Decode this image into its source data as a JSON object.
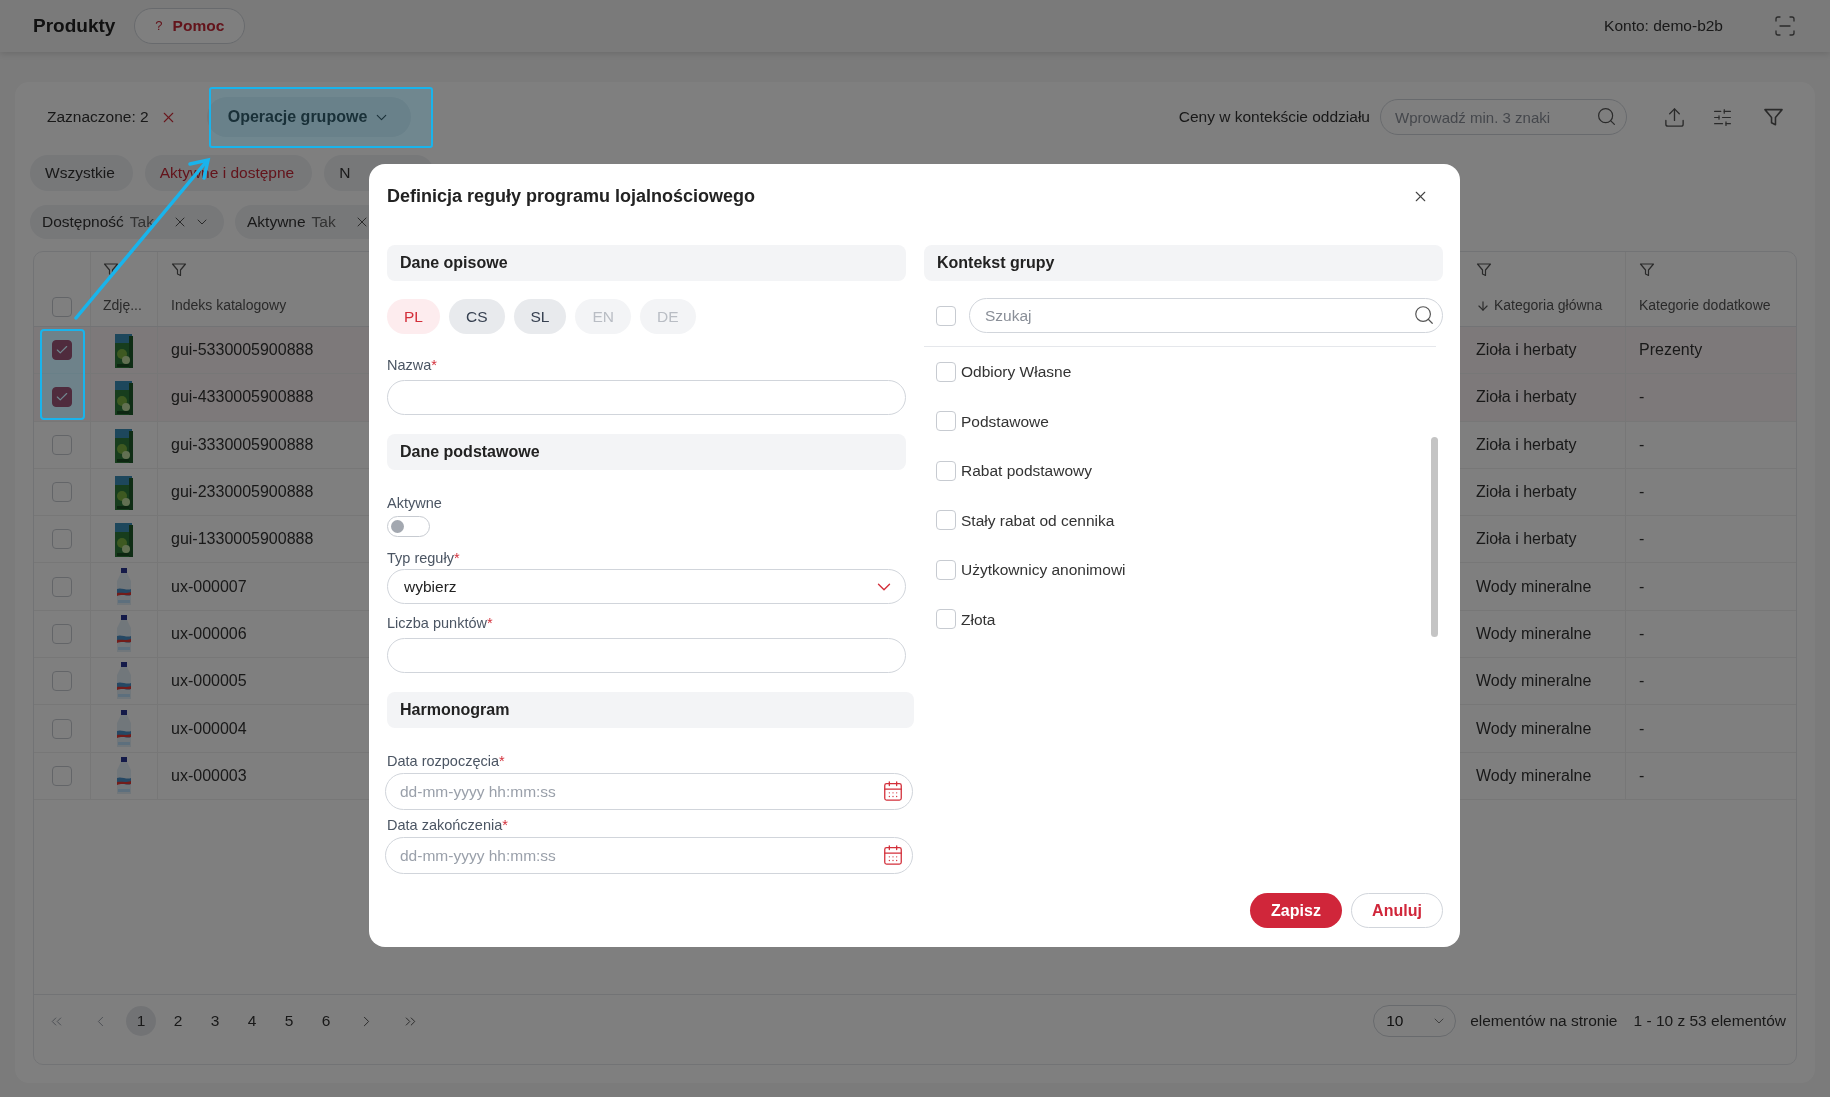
{
  "header": {
    "title": "Produkty",
    "help": {
      "icon": "?",
      "label": "Pomoc"
    },
    "account": "Konto: demo-b2b"
  },
  "toolbar": {
    "selection": "Zaznaczone: 2",
    "group_actions": "Operacje grupowe",
    "price_context": "Ceny w kontekście oddziału",
    "search": {
      "placeholder": "Wprowadź min. 3 znaki"
    }
  },
  "tabs": [
    {
      "label": "Wszystkie",
      "selected": false
    },
    {
      "label": "Aktywne i dostępne",
      "selected": true
    },
    {
      "label": "N",
      "selected": false
    }
  ],
  "filters": [
    {
      "label": "Dostępność",
      "value": "Tak",
      "dropdown": true
    },
    {
      "label": "Aktywne",
      "value": "Tak"
    }
  ],
  "table": {
    "all_selected": false,
    "columns": [
      {
        "label": "Zdję...",
        "filter": true
      },
      {
        "label": "Indeks katalogowy",
        "filter": true
      },
      {
        "label": "Kategoria główna",
        "filter": true,
        "sorted_descending": true
      },
      {
        "label": "Kategorie dodatkowe",
        "filter": true
      }
    ],
    "rows": [
      {
        "selected": true,
        "index": "gui-5330005900888",
        "main_category": "Zioła i herbaty",
        "extra_categories": "Prezenty"
      },
      {
        "selected": true,
        "index": "gui-4330005900888",
        "main_category": "Zioła i herbaty",
        "extra_categories": "-"
      },
      {
        "selected": false,
        "index": "gui-3330005900888",
        "main_category": "Zioła i herbaty",
        "extra_categories": "-"
      },
      {
        "selected": false,
        "index": "gui-2330005900888",
        "main_category": "Zioła i herbaty",
        "extra_categories": "-"
      },
      {
        "selected": false,
        "index": "gui-1330005900888",
        "main_category": "Zioła i herbaty",
        "extra_categories": "-"
      },
      {
        "selected": false,
        "index": "ux-000007",
        "main_category": "Wody mineralne",
        "extra_categories": "-"
      },
      {
        "selected": false,
        "index": "ux-000006",
        "main_category": "Wody mineralne",
        "extra_categories": "-"
      },
      {
        "selected": false,
        "index": "ux-000005",
        "main_category": "Wody mineralne",
        "extra_categories": "-"
      },
      {
        "selected": false,
        "index": "ux-000004",
        "main_category": "Wody mineralne",
        "extra_categories": "-"
      },
      {
        "selected": false,
        "index": "ux-000003",
        "main_category": "Wody mineralne",
        "extra_categories": "-"
      }
    ]
  },
  "pagination": {
    "pages": [
      {
        "label": "1",
        "selected": true
      },
      {
        "label": "2",
        "selected": false
      },
      {
        "label": "3",
        "selected": false
      },
      {
        "label": "4",
        "selected": false
      },
      {
        "label": "5",
        "selected": false
      },
      {
        "label": "6",
        "selected": false
      }
    ],
    "page_size": "10",
    "per_page_label": "elementów na stronie",
    "range": "1 - 10 z 53 elementów"
  },
  "dialog": {
    "title": "Definicja reguły programu lojalnościowego",
    "sections": [
      {
        "heading": "Dane opisowe",
        "items": [
          {
            "kind": "languages",
            "options": [
              {
                "code": "PL",
                "selected": true,
                "disabled": false
              },
              {
                "code": "CS",
                "selected": false,
                "disabled": false
              },
              {
                "code": "SL",
                "selected": false,
                "disabled": false
              },
              {
                "code": "EN",
                "selected": false,
                "disabled": true
              },
              {
                "code": "DE",
                "selected": false,
                "disabled": true
              }
            ]
          },
          {
            "kind": "text",
            "label": "Nazwa",
            "required_mark": "*"
          }
        ]
      },
      {
        "heading": "Dane podstawowe",
        "items": [
          {
            "kind": "toggle",
            "label": "Aktywne",
            "on": false
          },
          {
            "kind": "select",
            "label": "Typ reguły",
            "required_mark": "*",
            "value": "wybierz"
          },
          {
            "kind": "text",
            "label": "Liczba punktów",
            "required_mark": "*"
          }
        ]
      },
      {
        "heading": "Harmonogram",
        "items": [
          {
            "kind": "date",
            "label": "Data rozpoczęcia",
            "required_mark": "*",
            "placeholder": "dd-mm-yyyy hh:mm:ss"
          },
          {
            "kind": "date",
            "label": "Data zakończenia",
            "required_mark": "*",
            "placeholder": "dd-mm-yyyy hh:mm:ss"
          }
        ]
      }
    ],
    "groups": {
      "heading": "Kontekst grupy",
      "select_all": false,
      "search": {
        "placeholder": "Szukaj"
      },
      "items": [
        {
          "label": "Odbiory Własne",
          "checked": false
        },
        {
          "label": "Podstawowe",
          "checked": false
        },
        {
          "label": "Rabat podstawowy",
          "checked": false
        },
        {
          "label": "Stały rabat od cennika",
          "checked": false
        },
        {
          "label": "Użytkownicy anonimowi",
          "checked": false
        },
        {
          "label": "Złota",
          "checked": false
        }
      ]
    },
    "buttons": [
      {
        "label": "Zapisz",
        "kind": "primary"
      },
      {
        "label": "Anuluj",
        "kind": "secondary"
      }
    ]
  }
}
